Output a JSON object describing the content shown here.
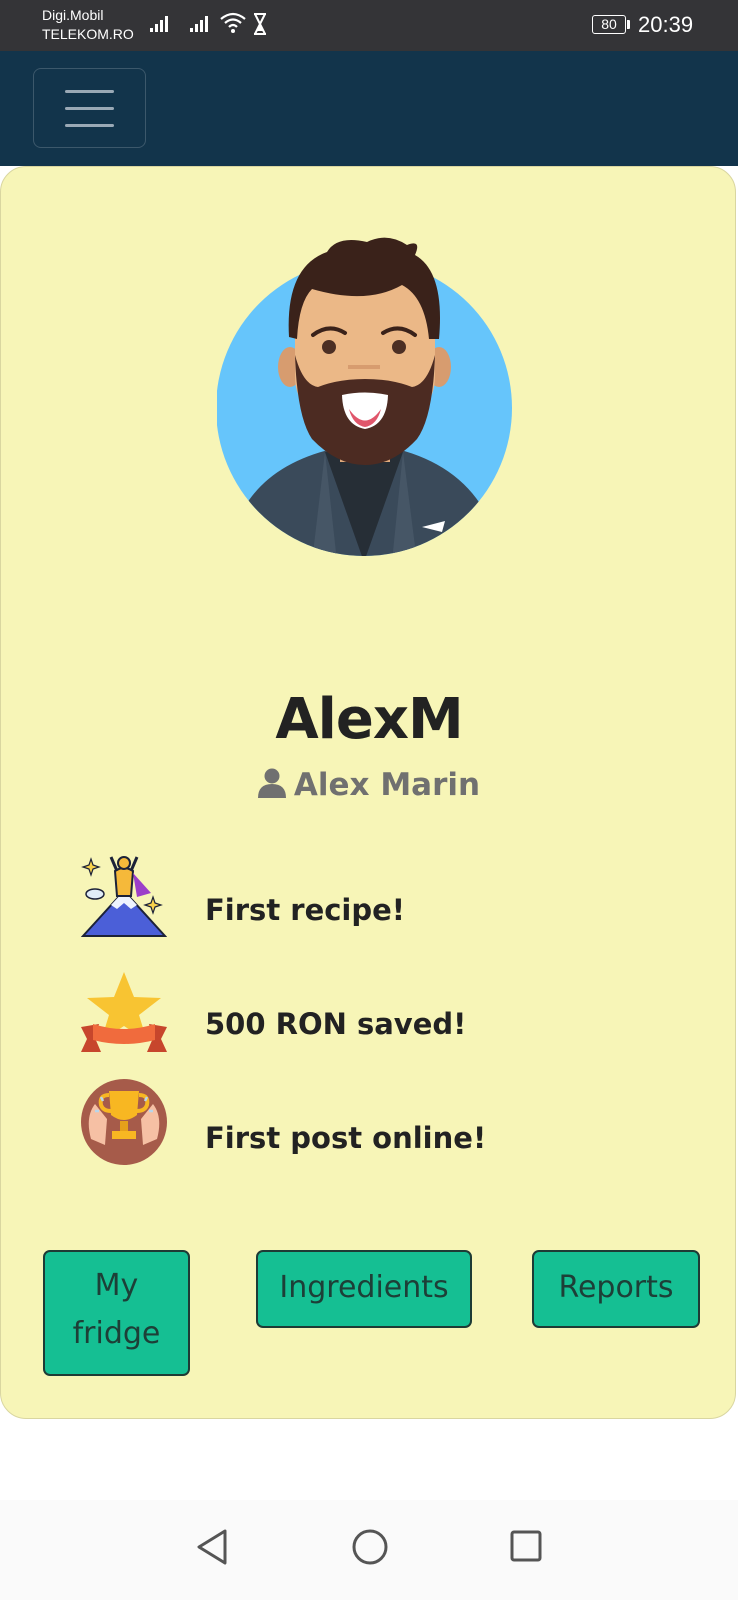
{
  "status_bar": {
    "carrier_line1": "Digi.Mobil",
    "carrier_line2": "TELEKOM.RO",
    "battery": "80",
    "time": "20:39"
  },
  "navbar": {
    "menu_icon": "hamburger-icon"
  },
  "profile": {
    "username": "AlexM",
    "full_name": "Alex Marin",
    "avatar_icon": "bearded-man-avatar",
    "user_icon": "person-icon"
  },
  "achievements": [
    {
      "icon": "mountain-summit-icon",
      "label": "First recipe!"
    },
    {
      "icon": "star-ribbon-icon",
      "label": "500 RON saved!"
    },
    {
      "icon": "trophy-hands-icon",
      "label": "First post online!"
    }
  ],
  "buttons": {
    "fridge_line1": "My",
    "fridge_line2": "fridge",
    "ingredients": "Ingredients",
    "reports": "Reports"
  },
  "colors": {
    "navbar": "#12344b",
    "card_background": "#f7f5b7",
    "button": "#15bf93"
  },
  "android_nav": [
    "back-icon",
    "home-icon",
    "recents-icon"
  ]
}
